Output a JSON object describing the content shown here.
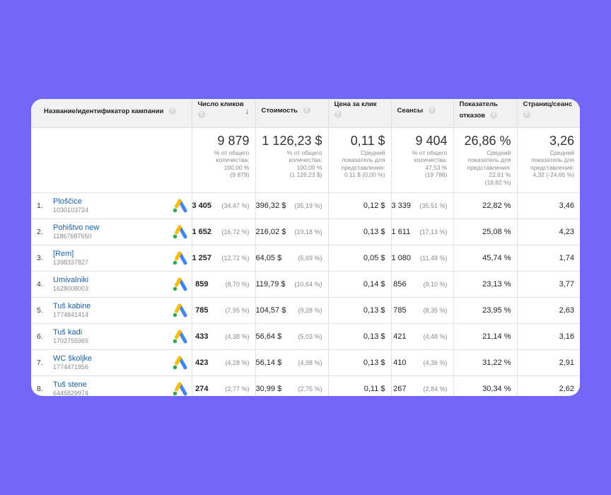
{
  "headers": {
    "campaign": "Название/идентификатор кампании",
    "clicks": "Число кликов",
    "cost": "Стоимость",
    "cpc": "Цена за клик",
    "sessions": "Сеансы",
    "bounce_line1": "Показатель",
    "bounce_line2": "отказов",
    "pages": "Страниц/сеанс",
    "help_glyph": "?",
    "sort_glyph": "↓"
  },
  "totals": {
    "clicks": {
      "big": "9 879",
      "l1": "% от общего",
      "l2": "количества:",
      "l3": "100,00 %",
      "l4": "(9 879)"
    },
    "cost": {
      "big": "1 126,23 $",
      "l1": "% от общего",
      "l2": "количества:",
      "l3": "100,00 %",
      "l4": "(1 126,23 $)"
    },
    "cpc": {
      "big": "0,11 $",
      "l1": "Средний",
      "l2": "показатель для",
      "l3": "представления:",
      "l4": "0,11 $ (0,00 %)"
    },
    "sessions": {
      "big": "9 404",
      "l1": "% от общего",
      "l2": "количества:",
      "l3": "47,53 %",
      "l4": "(19 786)"
    },
    "bounce": {
      "big": "26,86 %",
      "l1": "Средний",
      "l2": "показатель для",
      "l3": "представления:",
      "l4": "22,61 %",
      "l5": "(18,82 %)"
    },
    "pages": {
      "big": "3,26",
      "l1": "Средний",
      "l2": "показатель для",
      "l3": "представления:",
      "l4": "4,32 (-24,65 %)"
    }
  },
  "icons": {
    "ads": "google-ads-icon"
  },
  "colors": {
    "background": "#7367f8",
    "link": "#1a5fa8"
  },
  "rows": [
    {
      "idx": "1.",
      "name": "Ploščice",
      "id": "1030103724",
      "clicks": "3 405",
      "clicks_pct": "(34,47 %)",
      "cost": "396,32 $",
      "cost_pct": "(35,19 %)",
      "cpc": "0,12 $",
      "sessions": "3 339",
      "sessions_pct": "(35,51 %)",
      "bounce": "22,82 %",
      "pages": "3,46"
    },
    {
      "idx": "2.",
      "name": "Pohištvo new",
      "id": "11867687650",
      "clicks": "1 652",
      "clicks_pct": "(16,72 %)",
      "cost": "216,02 $",
      "cost_pct": "(19,18 %)",
      "cpc": "0,13 $",
      "sessions": "1 611",
      "sessions_pct": "(17,13 %)",
      "bounce": "25,08 %",
      "pages": "4,23"
    },
    {
      "idx": "3.",
      "name": "[Rem]",
      "id": "1398337827",
      "clicks": "1 257",
      "clicks_pct": "(12,72 %)",
      "cost": "64,05 $",
      "cost_pct": "(5,69 %)",
      "cpc": "0,05 $",
      "sessions": "1 080",
      "sessions_pct": "(11,48 %)",
      "bounce": "45,74 %",
      "pages": "1,74"
    },
    {
      "idx": "4.",
      "name": "Umivalniki",
      "id": "1628008003",
      "clicks": "859",
      "clicks_pct": "(8,70 %)",
      "cost": "119,79 $",
      "cost_pct": "(10,64 %)",
      "cpc": "0,14 $",
      "sessions": "856",
      "sessions_pct": "(9,10 %)",
      "bounce": "23,13 %",
      "pages": "3,77"
    },
    {
      "idx": "5.",
      "name": "Tuš kabine",
      "id": "1774841414",
      "clicks": "785",
      "clicks_pct": "(7,95 %)",
      "cost": "104,57 $",
      "cost_pct": "(9,28 %)",
      "cpc": "0,13 $",
      "sessions": "785",
      "sessions_pct": "(8,35 %)",
      "bounce": "23,95 %",
      "pages": "2,63"
    },
    {
      "idx": "6.",
      "name": "Tuš kadi",
      "id": "1702755965",
      "clicks": "433",
      "clicks_pct": "(4,38 %)",
      "cost": "56,64 $",
      "cost_pct": "(5,03 %)",
      "cpc": "0,13 $",
      "sessions": "421",
      "sessions_pct": "(4,48 %)",
      "bounce": "21,14 %",
      "pages": "3,16"
    },
    {
      "idx": "7.",
      "name": "WC školjke",
      "id": "1774471856",
      "clicks": "423",
      "clicks_pct": "(4,28 %)",
      "cost": "56,14 $",
      "cost_pct": "(4,98 %)",
      "cpc": "0,13 $",
      "sessions": "410",
      "sessions_pct": "(4,36 %)",
      "bounce": "31,22 %",
      "pages": "2,91"
    },
    {
      "idx": "8.",
      "name": "Tuš stene",
      "id": "6445829974",
      "clicks": "274",
      "clicks_pct": "(2,77 %)",
      "cost": "30,99 $",
      "cost_pct": "(2,75 %)",
      "cpc": "0,11 $",
      "sessions": "267",
      "sessions_pct": "(2,84 %)",
      "bounce": "30,34 %",
      "pages": "2,62"
    }
  ]
}
